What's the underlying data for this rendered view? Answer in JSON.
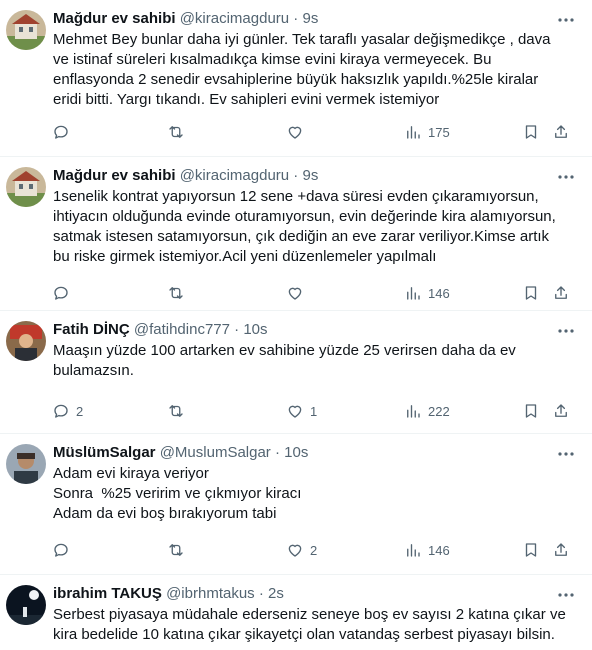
{
  "tweets": [
    {
      "name": "Mağdur ev sahibi",
      "handle": "@kiracimagduru",
      "time": "9s",
      "lines": [
        "Mehmet Bey bunlar daha iyi günler. Tek taraflı yasalar değişmedikçe , dava",
        "ve istinaf süreleri kısalmadıkça kimse evini kiraya vermeyecek. Bu",
        "enflasyonda 2 senedir evsahiplerine büyük haksızlık yapıldı.%25le kiralar",
        "eridi bitti. Yargı tıkandı. Ev sahipleri evini vermek istemiyor"
      ],
      "replies": "",
      "retweets": "",
      "likes": "",
      "views": "175"
    },
    {
      "name": "Mağdur ev sahibi",
      "handle": "@kiracimagduru",
      "time": "9s",
      "lines": [
        "1senelik kontrat yapıyorsun 12 sene +dava süresi evden çıkaramıyorsun,",
        "ihtiyacın olduğunda evinde oturamıyorsun, evin değerinde kira alamıyorsun,",
        "satmak istesen satamıyorsun, çık dediğin an eve zarar veriliyor.Kimse artık",
        "bu riske girmek istemiyor.Acil yeni düzenlemeler yapılmalı"
      ],
      "replies": "",
      "retweets": "",
      "likes": "",
      "views": "146"
    },
    {
      "name": "Fatih DİNÇ",
      "handle": "@fatihdinc777",
      "time": "10s",
      "lines": [
        "Maaşın yüzde 100 artarken ev sahibine yüzde 25 verirsen daha da ev",
        "bulamazsın."
      ],
      "replies": "2",
      "retweets": "",
      "likes": "1",
      "views": "222"
    },
    {
      "name": "MüslümSalgar",
      "handle": "@MuslumSalgar",
      "time": "10s",
      "lines": [
        "Adam evi kiraya veriyor",
        "Sonra  %25 veririm ve çıkmıyor kiracı",
        "Adam da evi boş bırakıyorum tabi"
      ],
      "replies": "",
      "retweets": "",
      "likes": "2",
      "views": "146"
    },
    {
      "name": "ibrahim TAKUŞ",
      "handle": "@ibrhmtakus",
      "time": "2s",
      "lines": [
        "Serbest piyasaya müdahale ederseniz seneye boş ev sayısı 2 katına çıkar ve",
        "kira bedelide 10 katına çıkar şikayetçi olan vatandaş serbest piyasayı bilsin."
      ],
      "replies": "",
      "retweets": "",
      "likes": "",
      "views": ""
    }
  ]
}
